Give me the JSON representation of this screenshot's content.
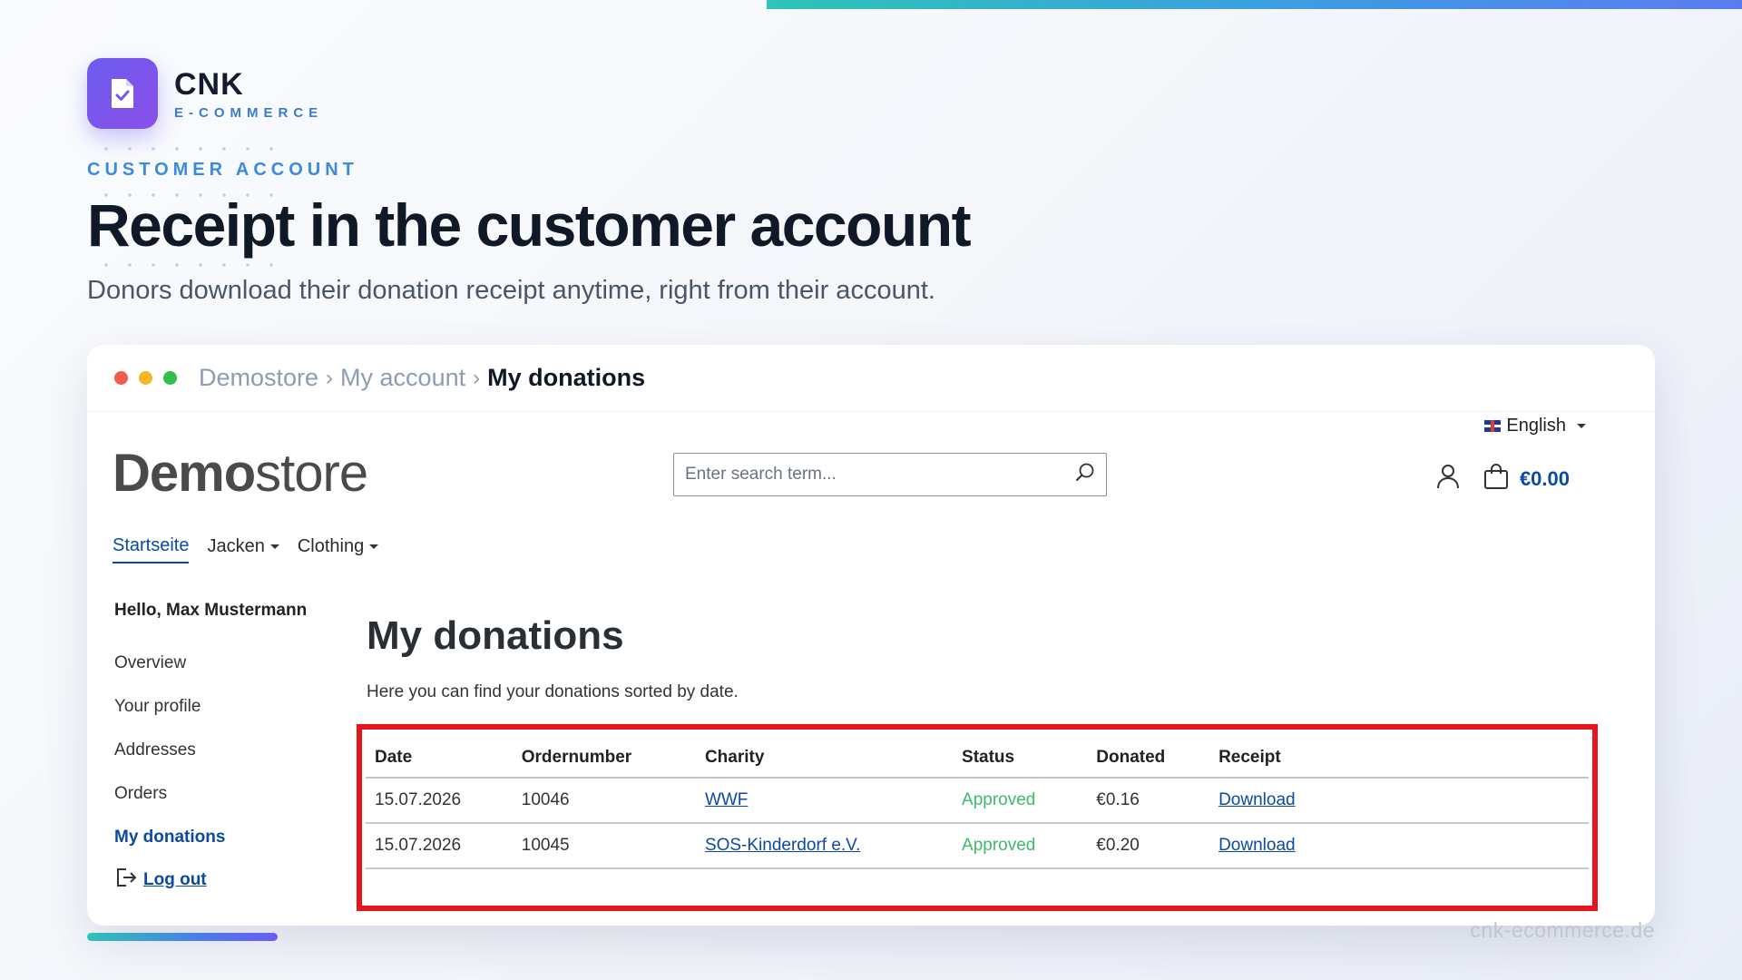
{
  "brand": {
    "name": "CNK",
    "sub": "E-COMMERCE"
  },
  "hero": {
    "eyebrow": "CUSTOMER ACCOUNT",
    "headline": "Receipt in the customer account",
    "subline": "Donors download their donation receipt anytime, right from their account."
  },
  "window": {
    "traffic_colors": [
      "#ef5b4f",
      "#f5b728",
      "#2fbf4a"
    ],
    "breadcrumb": [
      "Demostore",
      "My account",
      "My donations"
    ],
    "breadcrumb_sep": "›"
  },
  "store": {
    "logo_bold": "Demo",
    "logo_light": "store",
    "language": "English",
    "search_placeholder": "Enter search term...",
    "cart_total": "€0.00",
    "nav": [
      {
        "label": "Startseite"
      },
      {
        "label": "Jacken"
      },
      {
        "label": "Clothing"
      }
    ]
  },
  "sidebar": {
    "greeting": "Hello, Max Mustermann",
    "links": [
      "Overview",
      "Your profile",
      "Addresses",
      "Orders",
      "My donations"
    ],
    "logout": "Log out"
  },
  "main": {
    "title": "My donations",
    "intro": "Here you can find your donations sorted by date.",
    "columns": [
      "Date",
      "Ordernumber",
      "Charity",
      "Status",
      "Donated",
      "Receipt"
    ],
    "rows": [
      {
        "date": "15.07.2026",
        "order": "10046",
        "charity": "WWF",
        "status": "Approved",
        "donated": "€0.16",
        "receipt": "Download"
      },
      {
        "date": "15.07.2026",
        "order": "10045",
        "charity": "SOS-Kinderdorf e.V.",
        "status": "Approved",
        "donated": "€0.20",
        "receipt": "Download"
      }
    ]
  },
  "footer": {
    "watermark": "cnk-ecommerce.de"
  },
  "colors": {
    "accent": "#0b4aa2",
    "highlight": "#e8141b",
    "approved": "#3fb96a",
    "brand": "#6d5cf0"
  }
}
